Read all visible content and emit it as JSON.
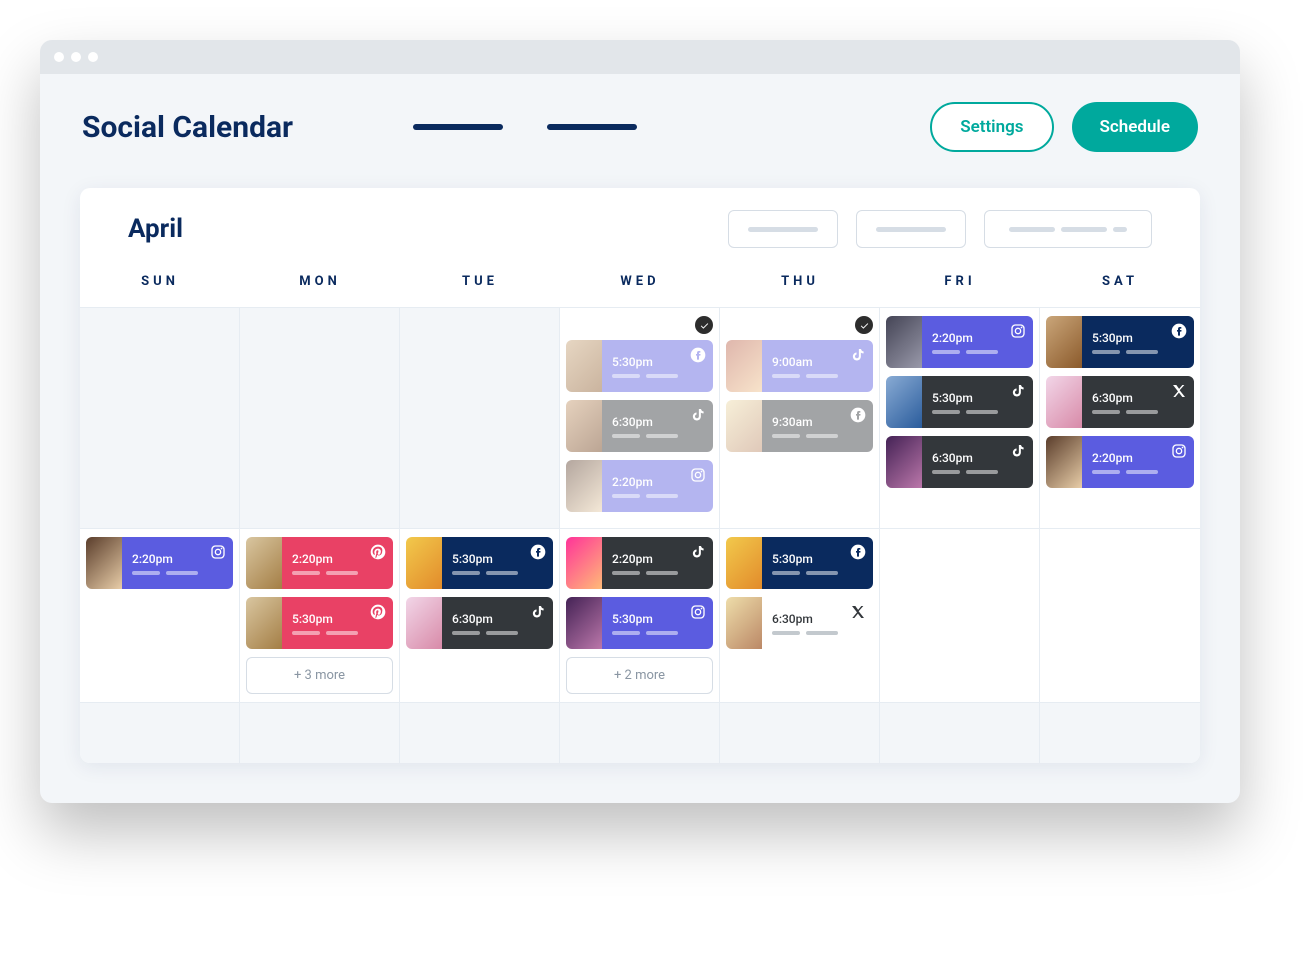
{
  "header": {
    "title": "Social Calendar",
    "settings_label": "Settings",
    "schedule_label": "Schedule"
  },
  "calendar": {
    "month_label": "April",
    "day_headers": [
      "SUN",
      "MON",
      "TUE",
      "WED",
      "THU",
      "FRI",
      "SAT"
    ],
    "weeks": [
      [
        {
          "empty": true
        },
        {
          "empty": true
        },
        {
          "empty": true
        },
        {
          "check": true,
          "dimmed": true,
          "events": [
            {
              "time": "5:30pm",
              "net": "facebook",
              "color": "indigo",
              "thumb": "t1"
            },
            {
              "time": "6:30pm",
              "net": "tiktok",
              "color": "dark",
              "thumb": "t3"
            },
            {
              "time": "2:20pm",
              "net": "instagram",
              "color": "indigo",
              "thumb": "t4"
            }
          ]
        },
        {
          "check": true,
          "dimmed": true,
          "events": [
            {
              "time": "9:00am",
              "net": "tiktok",
              "color": "indigo",
              "thumb": "t2"
            },
            {
              "time": "9:30am",
              "net": "facebook",
              "color": "dark",
              "thumb": "t12"
            }
          ]
        },
        {
          "events": [
            {
              "time": "2:20pm",
              "net": "instagram",
              "color": "indigo",
              "thumb": "t5"
            },
            {
              "time": "5:30pm",
              "net": "tiktok",
              "color": "dark",
              "thumb": "t10"
            },
            {
              "time": "6:30pm",
              "net": "tiktok",
              "color": "dark",
              "thumb": "t8"
            }
          ]
        },
        {
          "events": [
            {
              "time": "5:30pm",
              "net": "facebook",
              "color": "navy",
              "thumb": "t1"
            },
            {
              "time": "6:30pm",
              "net": "x",
              "color": "dark",
              "thumb": "t7"
            },
            {
              "time": "2:20pm",
              "net": "instagram",
              "color": "indigo",
              "thumb": "t4"
            }
          ]
        }
      ],
      [
        {
          "events": [
            {
              "time": "2:20pm",
              "net": "instagram",
              "color": "indigo",
              "thumb": "t4"
            }
          ]
        },
        {
          "events": [
            {
              "time": "2:20pm",
              "net": "pinterest",
              "color": "pink",
              "thumb": "t13"
            },
            {
              "time": "5:30pm",
              "net": "pinterest",
              "color": "pink",
              "thumb": "t13"
            }
          ],
          "more": "+ 3 more"
        },
        {
          "events": [
            {
              "time": "5:30pm",
              "net": "facebook",
              "color": "navy",
              "thumb": "t6"
            },
            {
              "time": "6:30pm",
              "net": "tiktok",
              "color": "dark",
              "thumb": "t7"
            }
          ]
        },
        {
          "events": [
            {
              "time": "2:20pm",
              "net": "tiktok",
              "color": "dark",
              "thumb": "t9"
            },
            {
              "time": "5:30pm",
              "net": "instagram",
              "color": "indigo",
              "thumb": "t8"
            }
          ],
          "more": "+ 2 more"
        },
        {
          "events": [
            {
              "time": "5:30pm",
              "net": "facebook",
              "color": "navy",
              "thumb": "t6"
            },
            {
              "time": "6:30pm",
              "net": "x",
              "color": "white",
              "thumb": "t12"
            }
          ]
        },
        {
          "empty_cell": true
        },
        {
          "empty_cell": true
        }
      ],
      [
        {
          "empty": true
        },
        {
          "empty": true
        },
        {
          "empty": true
        },
        {
          "empty": true
        },
        {
          "empty": true
        },
        {
          "empty": true
        },
        {
          "empty": true
        }
      ]
    ]
  }
}
